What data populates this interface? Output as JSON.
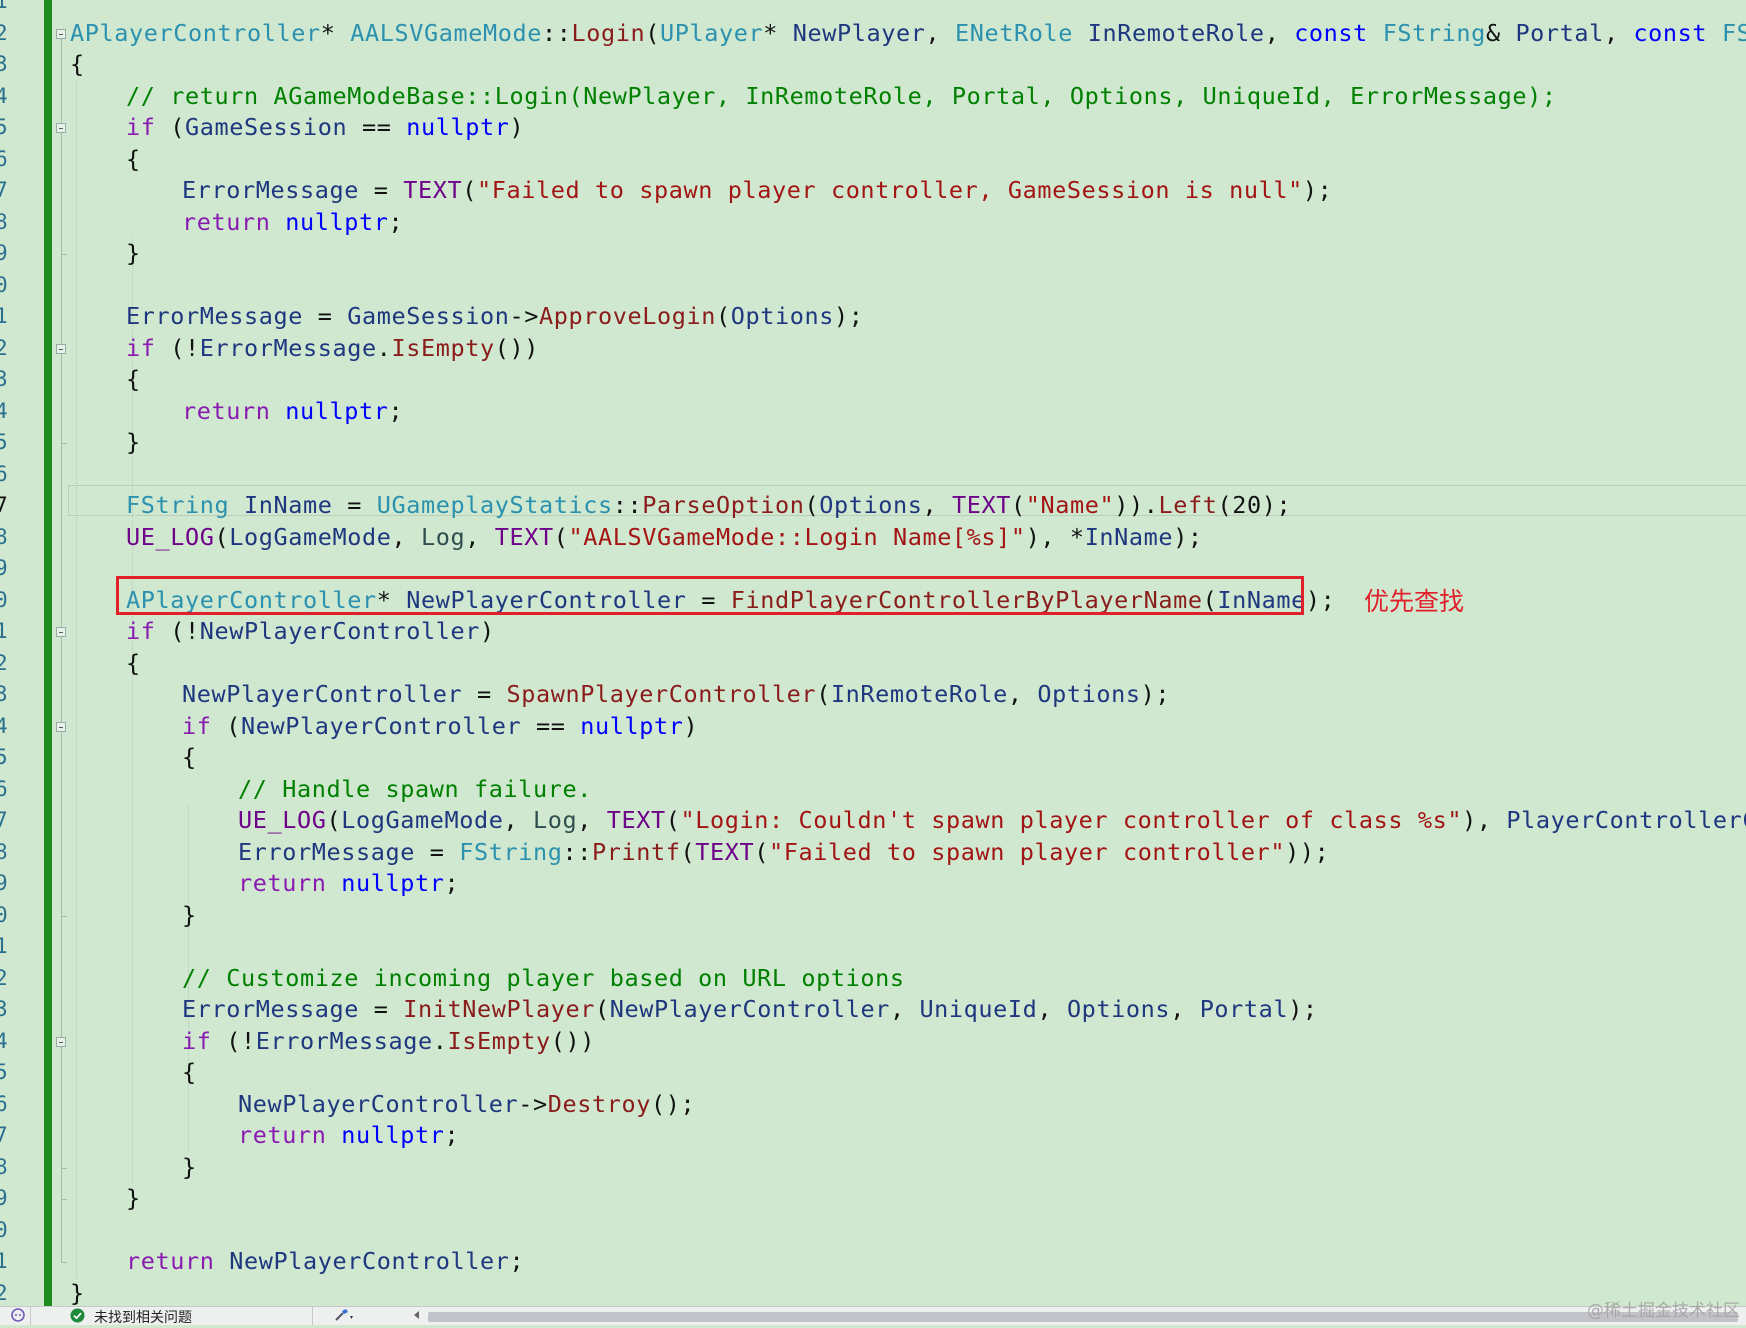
{
  "editor": {
    "line_numbers": [
      "1",
      "2",
      "3",
      "4",
      "5",
      "6",
      "7",
      "8",
      "9",
      "0",
      "1",
      "2",
      "3",
      "4",
      "5",
      "6",
      "7",
      "8",
      "9",
      "0",
      "1",
      "2",
      "3",
      "4",
      "5",
      "6",
      "7",
      "8",
      "9",
      "0",
      "1",
      "2",
      "3",
      "4",
      "5",
      "6",
      "7",
      "8",
      "9",
      "0",
      "1",
      "2"
    ],
    "lines": [
      [],
      [
        [
          "ty",
          "APlayerController"
        ],
        [
          "pun",
          "* "
        ],
        [
          "ty",
          "AALSVGameMode"
        ],
        [
          "pun",
          "::"
        ],
        [
          "fn",
          "Login"
        ],
        [
          "pun",
          "("
        ],
        [
          "ty",
          "UPlayer"
        ],
        [
          "pun",
          "* "
        ],
        [
          "id",
          "NewPlayer"
        ],
        [
          "pun",
          ", "
        ],
        [
          "ty",
          "ENetRole"
        ],
        [
          "pun",
          " "
        ],
        [
          "id",
          "InRemoteRole"
        ],
        [
          "pun",
          ", "
        ],
        [
          "kw",
          "const"
        ],
        [
          "pun",
          " "
        ],
        [
          "ty",
          "FString"
        ],
        [
          "pun",
          "& "
        ],
        [
          "id",
          "Portal"
        ],
        [
          "pun",
          ", "
        ],
        [
          "kw",
          "const"
        ],
        [
          "pun",
          " "
        ],
        [
          "ty",
          "FString"
        ],
        [
          "pun",
          "&"
        ]
      ],
      [
        [
          "pun",
          "{"
        ]
      ],
      [
        [
          "cm",
          "// return AGameModeBase::Login(NewPlayer, InRemoteRole, Portal, Options, UniqueId, ErrorMessage);"
        ]
      ],
      [
        [
          "kw2",
          "if"
        ],
        [
          "pun",
          " ("
        ],
        [
          "id",
          "GameSession"
        ],
        [
          "pun",
          " == "
        ],
        [
          "kw",
          "nullptr"
        ],
        [
          "pun",
          ")"
        ]
      ],
      [
        [
          "pun",
          "{"
        ]
      ],
      [
        [
          "id",
          "ErrorMessage"
        ],
        [
          "pun",
          " = "
        ],
        [
          "mac",
          "TEXT"
        ],
        [
          "pun",
          "("
        ],
        [
          "str",
          "\"Failed to spawn player controller, GameSession is null\""
        ],
        [
          "pun",
          ");"
        ]
      ],
      [
        [
          "kw2",
          "return"
        ],
        [
          "pun",
          " "
        ],
        [
          "kw",
          "nullptr"
        ],
        [
          "pun",
          ";"
        ]
      ],
      [
        [
          "pun",
          "}"
        ]
      ],
      [],
      [
        [
          "id",
          "ErrorMessage"
        ],
        [
          "pun",
          " = "
        ],
        [
          "id",
          "GameSession"
        ],
        [
          "pun",
          "->"
        ],
        [
          "fn",
          "ApproveLogin"
        ],
        [
          "pun",
          "("
        ],
        [
          "id",
          "Options"
        ],
        [
          "pun",
          ");"
        ]
      ],
      [
        [
          "kw2",
          "if"
        ],
        [
          "pun",
          " (!"
        ],
        [
          "id",
          "ErrorMessage"
        ],
        [
          "pun",
          "."
        ],
        [
          "fn",
          "IsEmpty"
        ],
        [
          "pun",
          "())"
        ]
      ],
      [
        [
          "pun",
          "{"
        ]
      ],
      [
        [
          "kw2",
          "return"
        ],
        [
          "pun",
          " "
        ],
        [
          "kw",
          "nullptr"
        ],
        [
          "pun",
          ";"
        ]
      ],
      [
        [
          "pun",
          "}"
        ]
      ],
      [],
      [
        [
          "ty",
          "FString"
        ],
        [
          "pun",
          " "
        ],
        [
          "id",
          "InName"
        ],
        [
          "pun",
          " = "
        ],
        [
          "ty",
          "UGameplayStatics"
        ],
        [
          "pun",
          "::"
        ],
        [
          "fn",
          "ParseOption"
        ],
        [
          "pun",
          "("
        ],
        [
          "id",
          "Options"
        ],
        [
          "pun",
          ", "
        ],
        [
          "mac",
          "TEXT"
        ],
        [
          "pun",
          "("
        ],
        [
          "str",
          "\"Name\""
        ],
        [
          "pun",
          "))."
        ],
        [
          "fn",
          "Left"
        ],
        [
          "pun",
          "(20);"
        ]
      ],
      [
        [
          "mac",
          "UE_LOG"
        ],
        [
          "pun",
          "("
        ],
        [
          "id",
          "LogGameMode"
        ],
        [
          "pun",
          ", "
        ],
        [
          "en",
          "Log"
        ],
        [
          "pun",
          ", "
        ],
        [
          "mac",
          "TEXT"
        ],
        [
          "pun",
          "("
        ],
        [
          "str",
          "\"AALSVGameMode::Login Name[%s]\""
        ],
        [
          "pun",
          "), *"
        ],
        [
          "id",
          "InName"
        ],
        [
          "pun",
          ");"
        ]
      ],
      [],
      [
        [
          "ty",
          "APlayerController"
        ],
        [
          "pun",
          "* "
        ],
        [
          "id",
          "NewPlayerController"
        ],
        [
          "pun",
          " = "
        ],
        [
          "fn",
          "FindPlayerControllerByPlayerName"
        ],
        [
          "pun",
          "("
        ],
        [
          "id",
          "InName"
        ],
        [
          "pun",
          ");"
        ]
      ],
      [
        [
          "kw2",
          "if"
        ],
        [
          "pun",
          " (!"
        ],
        [
          "id",
          "NewPlayerController"
        ],
        [
          "pun",
          ")"
        ]
      ],
      [
        [
          "pun",
          "{"
        ]
      ],
      [
        [
          "id",
          "NewPlayerController"
        ],
        [
          "pun",
          " = "
        ],
        [
          "fn",
          "SpawnPlayerController"
        ],
        [
          "pun",
          "("
        ],
        [
          "id",
          "InRemoteRole"
        ],
        [
          "pun",
          ", "
        ],
        [
          "id",
          "Options"
        ],
        [
          "pun",
          ");"
        ]
      ],
      [
        [
          "kw2",
          "if"
        ],
        [
          "pun",
          " ("
        ],
        [
          "id",
          "NewPlayerController"
        ],
        [
          "pun",
          " == "
        ],
        [
          "kw",
          "nullptr"
        ],
        [
          "pun",
          ")"
        ]
      ],
      [
        [
          "pun",
          "{"
        ]
      ],
      [
        [
          "cm",
          "// Handle spawn failure."
        ]
      ],
      [
        [
          "mac",
          "UE_LOG"
        ],
        [
          "pun",
          "("
        ],
        [
          "id",
          "LogGameMode"
        ],
        [
          "pun",
          ", "
        ],
        [
          "en",
          "Log"
        ],
        [
          "pun",
          ", "
        ],
        [
          "mac",
          "TEXT"
        ],
        [
          "pun",
          "("
        ],
        [
          "str",
          "\"Login: Couldn't spawn player controller of class %s\""
        ],
        [
          "pun",
          "), "
        ],
        [
          "id",
          "PlayerControllerClass"
        ]
      ],
      [
        [
          "id",
          "ErrorMessage"
        ],
        [
          "pun",
          " = "
        ],
        [
          "ty",
          "FString"
        ],
        [
          "pun",
          "::"
        ],
        [
          "fn",
          "Printf"
        ],
        [
          "pun",
          "("
        ],
        [
          "mac",
          "TEXT"
        ],
        [
          "pun",
          "("
        ],
        [
          "str",
          "\"Failed to spawn player controller\""
        ],
        [
          "pun",
          "));"
        ]
      ],
      [
        [
          "kw2",
          "return"
        ],
        [
          "pun",
          " "
        ],
        [
          "kw",
          "nullptr"
        ],
        [
          "pun",
          ";"
        ]
      ],
      [
        [
          "pun",
          "}"
        ]
      ],
      [],
      [
        [
          "cm",
          "// Customize incoming player based on URL options"
        ]
      ],
      [
        [
          "id",
          "ErrorMessage"
        ],
        [
          "pun",
          " = "
        ],
        [
          "fn",
          "InitNewPlayer"
        ],
        [
          "pun",
          "("
        ],
        [
          "id",
          "NewPlayerController"
        ],
        [
          "pun",
          ", "
        ],
        [
          "id",
          "UniqueId"
        ],
        [
          "pun",
          ", "
        ],
        [
          "id",
          "Options"
        ],
        [
          "pun",
          ", "
        ],
        [
          "id",
          "Portal"
        ],
        [
          "pun",
          ");"
        ]
      ],
      [
        [
          "kw2",
          "if"
        ],
        [
          "pun",
          " (!"
        ],
        [
          "id",
          "ErrorMessage"
        ],
        [
          "pun",
          "."
        ],
        [
          "fn",
          "IsEmpty"
        ],
        [
          "pun",
          "())"
        ]
      ],
      [
        [
          "pun",
          "{"
        ]
      ],
      [
        [
          "id",
          "NewPlayerController"
        ],
        [
          "pun",
          "->"
        ],
        [
          "fn",
          "Destroy"
        ],
        [
          "pun",
          "();"
        ]
      ],
      [
        [
          "kw2",
          "return"
        ],
        [
          "pun",
          " "
        ],
        [
          "kw",
          "nullptr"
        ],
        [
          "pun",
          ";"
        ]
      ],
      [
        [
          "pun",
          "}"
        ]
      ],
      [
        [
          "pun",
          "}"
        ]
      ],
      [],
      [
        [
          "kw2",
          "return"
        ],
        [
          "pun",
          " "
        ],
        [
          "id",
          "NewPlayerController"
        ],
        [
          "pun",
          ";"
        ]
      ],
      [
        [
          "pun",
          "}"
        ]
      ]
    ]
  },
  "annotation": {
    "label": "优先查找",
    "color": "#e0202a"
  },
  "status_bar": {
    "issues_label": "未找到相关问题",
    "ok_icon": "check-circle-icon",
    "copilot_icon": "copilot-icon",
    "brush_icon": "code-cleanup-icon"
  },
  "watermark": {
    "text": "@稀土掘金技术社区"
  },
  "colors": {
    "editor_bg": "#cfe8cf",
    "change_bar": "#1e8c1e",
    "keyword": "#0000ff",
    "control_keyword": "#8a1bb1",
    "type": "#2b91af",
    "function": "#8b1c1c",
    "string": "#a31515",
    "comment": "#008000"
  }
}
